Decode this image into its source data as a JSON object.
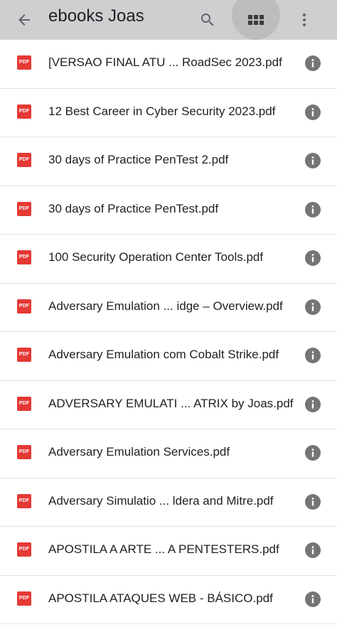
{
  "toolbar": {
    "title": "ebooks Joas",
    "icons": {
      "back": "arrow-back-icon",
      "search": "search-icon",
      "grid": "grid-view-icon",
      "more": "more-vert-icon"
    },
    "background": "#cfcfd1"
  },
  "file_icon_label": "PDF",
  "file_icon_color": "#e53935",
  "info_icon_color": "#757575",
  "files": [
    {
      "name": "[VERSAO FINAL ATU ... RoadSec 2023.pdf"
    },
    {
      "name": "12 Best Career in Cyber Security 2023.pdf"
    },
    {
      "name": "30 days of Practice PenTest 2.pdf"
    },
    {
      "name": "30 days of Practice PenTest.pdf"
    },
    {
      "name": "100 Security Operation Center Tools.pdf"
    },
    {
      "name": "Adversary Emulation ... idge – Overview.pdf"
    },
    {
      "name": "Adversary Emulation com Cobalt Strike.pdf"
    },
    {
      "name": "ADVERSARY EMULATI ... ATRIX by Joas.pdf"
    },
    {
      "name": "Adversary Emulation Services.pdf"
    },
    {
      "name": "Adversary Simulatio ... ldera and Mitre.pdf"
    },
    {
      "name": "APOSTILA A ARTE ... A PENTESTERS.pdf"
    },
    {
      "name": "APOSTILA ATAQUES WEB - BÁSICO.pdf"
    }
  ]
}
